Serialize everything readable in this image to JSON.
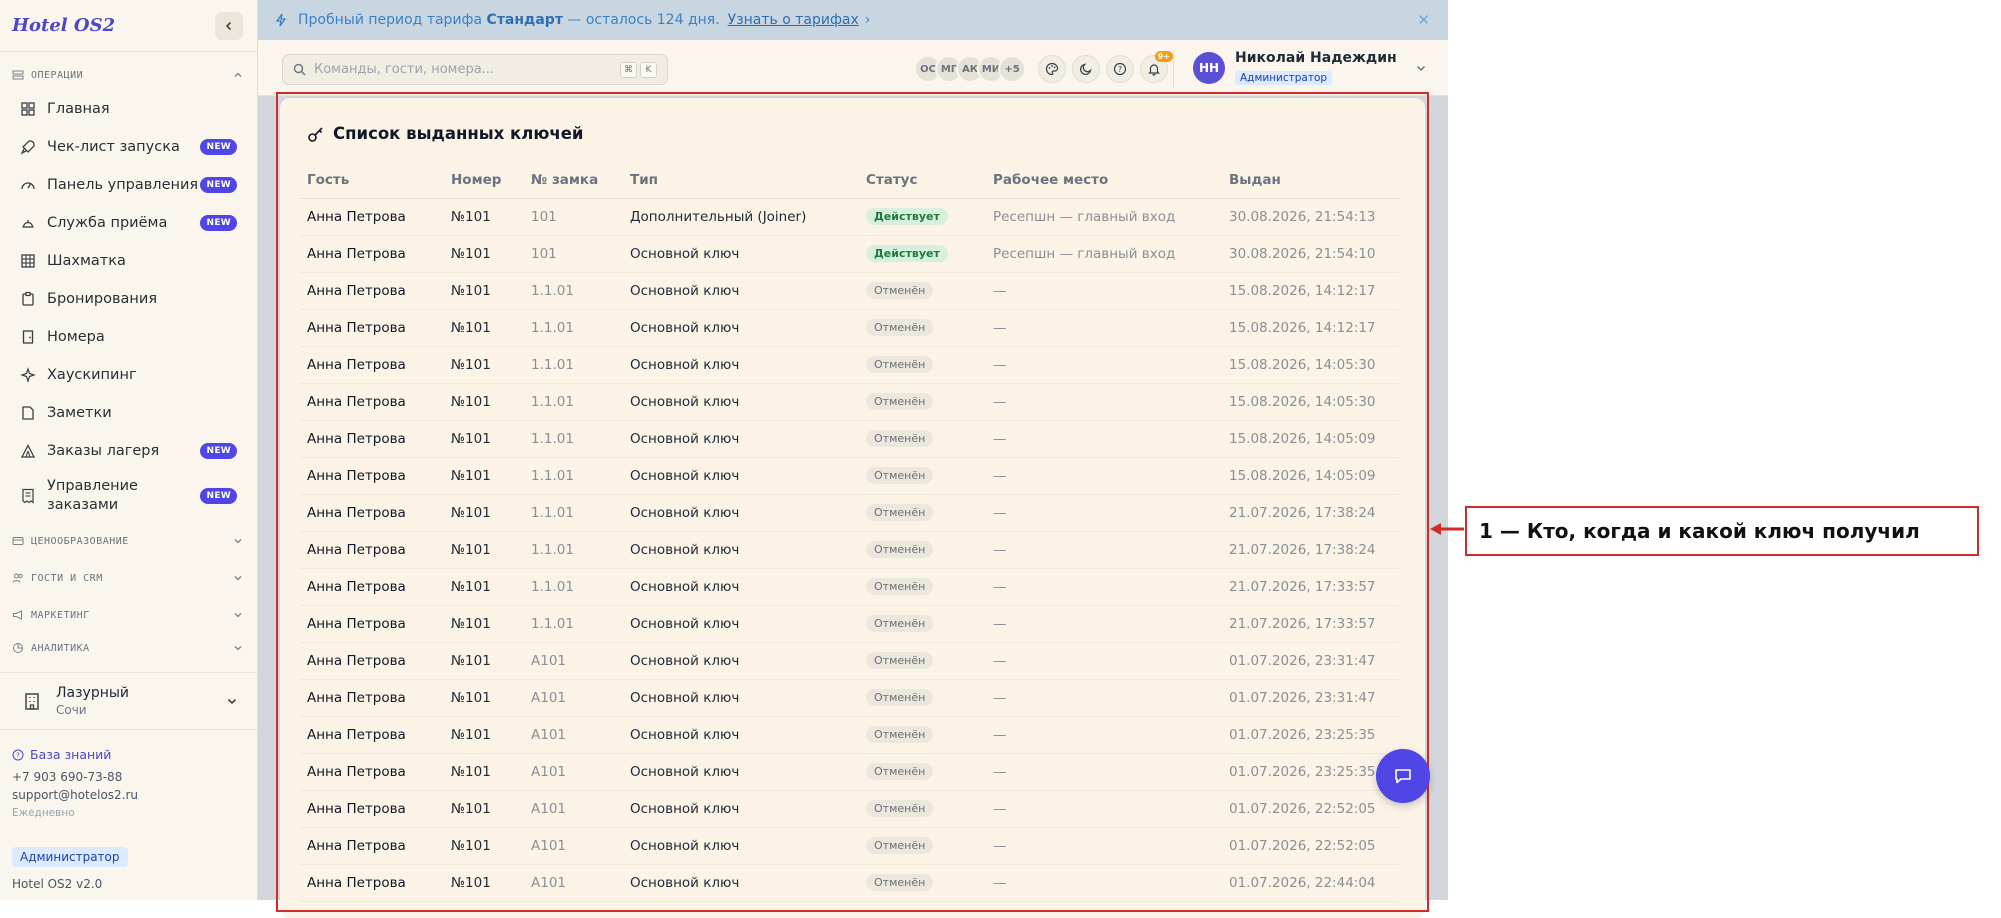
{
  "app": {
    "brand": "Hotel OS2",
    "version": "Hotel OS2 v2.0",
    "role_pill": "Администратор"
  },
  "banner": {
    "prefix": "Пробный период тарифа",
    "plan": "Стандарт",
    "suffix": "— осталось 124 дня.",
    "link": "Узнать о тарифах",
    "link_chevron": "›",
    "close": "✕"
  },
  "sidebar": {
    "sections": {
      "operations": "ОПЕРАЦИИ",
      "pricing": "ЦЕНООБРАЗОВАНИЕ",
      "guests": "ГОСТИ И CRM",
      "marketing": "МАРКЕТИНГ",
      "analytics": "АНАЛИТИКА"
    },
    "new_badge": "NEW",
    "items": [
      {
        "label": "Главная",
        "icon": "dashboard-icon",
        "new": false
      },
      {
        "label": "Чек-лист запуска",
        "icon": "rocket-icon",
        "new": true
      },
      {
        "label": "Панель управления",
        "icon": "gauge-icon",
        "new": true
      },
      {
        "label": "Служба приёма",
        "icon": "bell-desk-icon",
        "new": true
      },
      {
        "label": "Шахматка",
        "icon": "grid-icon",
        "new": false
      },
      {
        "label": "Бронирования",
        "icon": "clipboard-icon",
        "new": false
      },
      {
        "label": "Номера",
        "icon": "door-icon",
        "new": false
      },
      {
        "label": "Хаускипинг",
        "icon": "sparkle-icon",
        "new": false
      },
      {
        "label": "Заметки",
        "icon": "note-icon",
        "new": false
      },
      {
        "label": "Заказы лагеря",
        "icon": "tent-icon",
        "new": true
      },
      {
        "label": "Управление заказами",
        "icon": "receipt-icon",
        "new": true
      }
    ],
    "hotel": {
      "name": "Лазурный",
      "city": "Сочи"
    },
    "support": {
      "kb": "База знаний",
      "phone": "+7 903 690-73-88",
      "email": "support@hotelos2.ru",
      "hours": "Ежедневно"
    }
  },
  "topbar": {
    "search_placeholder": "Команды, гости, номера...",
    "kbd1": "⌘",
    "kbd2": "K",
    "online_users": [
      "ОС",
      "МГ",
      "АК",
      "МИ",
      "+5"
    ],
    "notifications_count": "9+",
    "user": {
      "initials": "НН",
      "name": "Николай Надеждин",
      "role": "Администратор"
    }
  },
  "main": {
    "title": "Список выданных ключей",
    "columns": [
      "Гость",
      "Номер",
      "№ замка",
      "Тип",
      "Статус",
      "Рабочее место",
      "Выдан"
    ],
    "rows": [
      {
        "guest": "Анна Петрова",
        "room": "№101",
        "lock": "101",
        "type": "Дополнительный (Joiner)",
        "status": "Действует",
        "status_kind": "active",
        "workstation": "Ресепшн — главный вход",
        "issued": "30.08.2026, 21:54:13"
      },
      {
        "guest": "Анна Петрова",
        "room": "№101",
        "lock": "101",
        "type": "Основной ключ",
        "status": "Действует",
        "status_kind": "active",
        "workstation": "Ресепшн — главный вход",
        "issued": "30.08.2026, 21:54:10"
      },
      {
        "guest": "Анна Петрова",
        "room": "№101",
        "lock": "1.1.01",
        "type": "Основной ключ",
        "status": "Отменён",
        "status_kind": "cancelled",
        "workstation": "—",
        "issued": "15.08.2026, 14:12:17"
      },
      {
        "guest": "Анна Петрова",
        "room": "№101",
        "lock": "1.1.01",
        "type": "Основной ключ",
        "status": "Отменён",
        "status_kind": "cancelled",
        "workstation": "—",
        "issued": "15.08.2026, 14:12:17"
      },
      {
        "guest": "Анна Петрова",
        "room": "№101",
        "lock": "1.1.01",
        "type": "Основной ключ",
        "status": "Отменён",
        "status_kind": "cancelled",
        "workstation": "—",
        "issued": "15.08.2026, 14:05:30"
      },
      {
        "guest": "Анна Петрова",
        "room": "№101",
        "lock": "1.1.01",
        "type": "Основной ключ",
        "status": "Отменён",
        "status_kind": "cancelled",
        "workstation": "—",
        "issued": "15.08.2026, 14:05:30"
      },
      {
        "guest": "Анна Петрова",
        "room": "№101",
        "lock": "1.1.01",
        "type": "Основной ключ",
        "status": "Отменён",
        "status_kind": "cancelled",
        "workstation": "—",
        "issued": "15.08.2026, 14:05:09"
      },
      {
        "guest": "Анна Петрова",
        "room": "№101",
        "lock": "1.1.01",
        "type": "Основной ключ",
        "status": "Отменён",
        "status_kind": "cancelled",
        "workstation": "—",
        "issued": "15.08.2026, 14:05:09"
      },
      {
        "guest": "Анна Петрова",
        "room": "№101",
        "lock": "1.1.01",
        "type": "Основной ключ",
        "status": "Отменён",
        "status_kind": "cancelled",
        "workstation": "—",
        "issued": "21.07.2026, 17:38:24"
      },
      {
        "guest": "Анна Петрова",
        "room": "№101",
        "lock": "1.1.01",
        "type": "Основной ключ",
        "status": "Отменён",
        "status_kind": "cancelled",
        "workstation": "—",
        "issued": "21.07.2026, 17:38:24"
      },
      {
        "guest": "Анна Петрова",
        "room": "№101",
        "lock": "1.1.01",
        "type": "Основной ключ",
        "status": "Отменён",
        "status_kind": "cancelled",
        "workstation": "—",
        "issued": "21.07.2026, 17:33:57"
      },
      {
        "guest": "Анна Петрова",
        "room": "№101",
        "lock": "1.1.01",
        "type": "Основной ключ",
        "status": "Отменён",
        "status_kind": "cancelled",
        "workstation": "—",
        "issued": "21.07.2026, 17:33:57"
      },
      {
        "guest": "Анна Петрова",
        "room": "№101",
        "lock": "A101",
        "type": "Основной ключ",
        "status": "Отменён",
        "status_kind": "cancelled",
        "workstation": "—",
        "issued": "01.07.2026, 23:31:47"
      },
      {
        "guest": "Анна Петрова",
        "room": "№101",
        "lock": "A101",
        "type": "Основной ключ",
        "status": "Отменён",
        "status_kind": "cancelled",
        "workstation": "—",
        "issued": "01.07.2026, 23:31:47"
      },
      {
        "guest": "Анна Петрова",
        "room": "№101",
        "lock": "A101",
        "type": "Основной ключ",
        "status": "Отменён",
        "status_kind": "cancelled",
        "workstation": "—",
        "issued": "01.07.2026, 23:25:35"
      },
      {
        "guest": "Анна Петрова",
        "room": "№101",
        "lock": "A101",
        "type": "Основной ключ",
        "status": "Отменён",
        "status_kind": "cancelled",
        "workstation": "—",
        "issued": "01.07.2026, 23:25:35"
      },
      {
        "guest": "Анна Петрова",
        "room": "№101",
        "lock": "A101",
        "type": "Основной ключ",
        "status": "Отменён",
        "status_kind": "cancelled",
        "workstation": "—",
        "issued": "01.07.2026, 22:52:05"
      },
      {
        "guest": "Анна Петрова",
        "room": "№101",
        "lock": "A101",
        "type": "Основной ключ",
        "status": "Отменён",
        "status_kind": "cancelled",
        "workstation": "—",
        "issued": "01.07.2026, 22:52:05"
      },
      {
        "guest": "Анна Петрова",
        "room": "№101",
        "lock": "A101",
        "type": "Основной ключ",
        "status": "Отменён",
        "status_kind": "cancelled",
        "workstation": "—",
        "issued": "01.07.2026, 22:44:04"
      }
    ]
  },
  "annotation": {
    "label": "1 — Кто, когда и какой ключ получил"
  },
  "colors": {
    "accent": "#4f46e5",
    "annotation_red": "#d12a2a",
    "active_status_bg": "#d6f0dd",
    "banner_bg": "#c8d6e2"
  }
}
